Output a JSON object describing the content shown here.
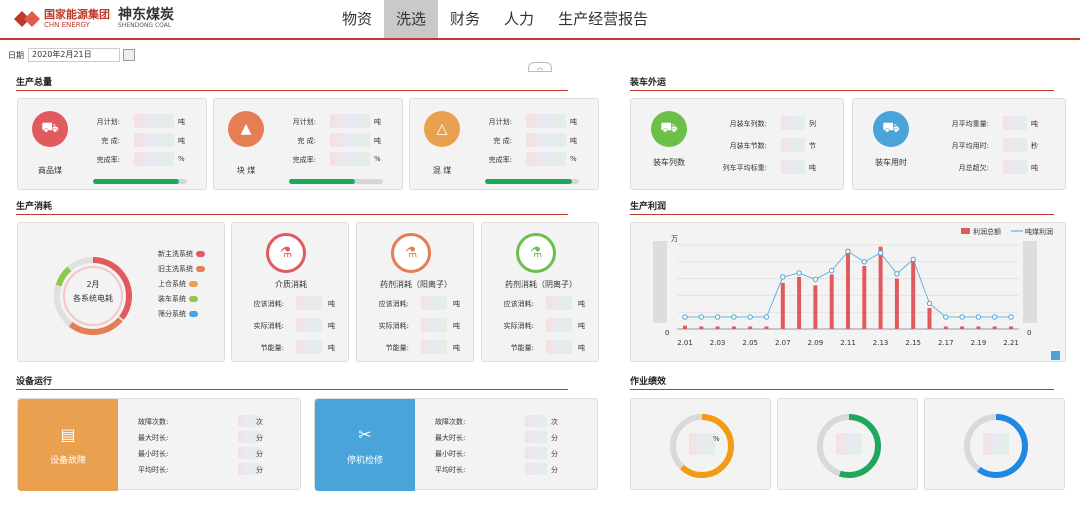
{
  "header": {
    "logo_cn": "国家能源集团",
    "logo_en": "CHN ENERGY",
    "logo2_cn": "神东煤炭",
    "logo2_en": "SHENDONG COAL",
    "nav": [
      "物资",
      "洗选",
      "财务",
      "人力",
      "生产经营报告"
    ]
  },
  "date": {
    "label": "日期",
    "value": "2020年2月21日"
  },
  "collapse": "︿",
  "sections": {
    "prod_total": "生产总量",
    "load": "装车外运",
    "consume": "生产消耗",
    "profit": "生产利润",
    "device": "设备运行",
    "perf": "作业绩效"
  },
  "prod": [
    {
      "name": "商品煤",
      "color": "#e05a5f",
      "icon": "coal-icon",
      "progress": 0.92
    },
    {
      "name": "块  煤",
      "color": "#e57d55",
      "icon": "block-icon",
      "progress": 0.7
    },
    {
      "name": "混  煤",
      "color": "#e9a14f",
      "icon": "mix-icon",
      "progress": 0.93
    }
  ],
  "prod_labels": {
    "plan": "月计划:",
    "done": "完  成:",
    "rate": "完成率:",
    "unit_t": "吨",
    "unit_pct": "%"
  },
  "load_cards": [
    {
      "name": "装车列数",
      "color": "#6cc04a",
      "rows": [
        [
          "月装车列数:",
          "列"
        ],
        [
          "月装车节数:",
          "节"
        ],
        [
          "列车平均标重:",
          "吨"
        ]
      ]
    },
    {
      "name": "装车用时",
      "color": "#4aa3d9",
      "rows": [
        [
          "月平均重量:",
          "吨"
        ],
        [
          "月平均用时:",
          "秒"
        ],
        [
          "月总超欠:",
          "吨"
        ]
      ]
    }
  ],
  "consume": {
    "ring_text1": "2月",
    "ring_text2": "各系统电耗",
    "legend": [
      [
        "新主洗系统",
        "#e05a5f"
      ],
      [
        "旧主洗系统",
        "#e57d55"
      ],
      [
        "上仓系统",
        "#e9a14f"
      ],
      [
        "装车系统",
        "#8cc84b"
      ],
      [
        "筛分系统",
        "#4aa3d9"
      ]
    ],
    "cards": [
      {
        "name": "介质消耗",
        "color": "#e05a5f",
        "r3": "-"
      },
      {
        "name": "药剂消耗（阳离子）",
        "color": "#e57d55",
        "r3": ""
      },
      {
        "name": "药剂消耗（阴离子）",
        "color": "#6cc04a",
        "r3": "-5"
      }
    ],
    "rows": [
      "应该消耗:",
      "实际消耗:",
      "节能量:"
    ],
    "unit": "吨"
  },
  "chart_data": {
    "type": "bar",
    "x": [
      "2.01",
      "2.02",
      "2.03",
      "2.04",
      "2.05",
      "2.06",
      "2.07",
      "2.08",
      "2.09",
      "2.10",
      "2.11",
      "2.12",
      "2.13",
      "2.14",
      "2.15",
      "2.16",
      "2.17",
      "2.18",
      "2.19",
      "2.20",
      "2.21"
    ],
    "xticks": [
      "2.01",
      "2.03",
      "2.05",
      "2.07",
      "2.09",
      "2.11",
      "2.13",
      "2.15",
      "2.17",
      "2.19",
      "2.21"
    ],
    "series": [
      {
        "name": "利润总额",
        "type": "bar",
        "color": "#e05a5f",
        "values": [
          0.04,
          0.03,
          0.03,
          0.03,
          0.03,
          0.03,
          0.55,
          0.62,
          0.52,
          0.65,
          0.95,
          0.75,
          0.98,
          0.6,
          0.85,
          0.25,
          0.03,
          0.03,
          0.03,
          0.03,
          0.03
        ]
      },
      {
        "name": "吨煤利润",
        "type": "line",
        "color": "#4aa3d9",
        "values": [
          0.1,
          0.1,
          0.1,
          0.1,
          0.1,
          0.1,
          0.6,
          0.65,
          0.57,
          0.68,
          0.92,
          0.79,
          0.9,
          0.64,
          0.82,
          0.27,
          0.1,
          0.1,
          0.1,
          0.1,
          0.1
        ]
      }
    ],
    "ylabel": "万",
    "yticks_left": [
      "0"
    ],
    "yticks_right": [
      "0"
    ]
  },
  "device": [
    {
      "name": "设备故障",
      "color": "#e9a14f",
      "rows": [
        [
          "故障次数:",
          "次"
        ],
        [
          "最大时长:",
          "分"
        ],
        [
          "最小时长:",
          "分"
        ],
        [
          "平均时长:",
          "分"
        ]
      ]
    },
    {
      "name": "停机检修",
      "color": "#4aa3d9",
      "rows": [
        [
          "故障次数:",
          "次"
        ],
        [
          "最大时长:",
          "分"
        ],
        [
          "最小时长:",
          "分"
        ],
        [
          "平均时长:",
          "分"
        ]
      ]
    }
  ],
  "perf": [
    {
      "color": "#f39c12",
      "label": "%",
      "pct": 0.62
    },
    {
      "color": "#1fa85b",
      "label": "",
      "pct": 0.55
    },
    {
      "color": "#1e88e5",
      "label": "",
      "pct": 0.6
    }
  ]
}
